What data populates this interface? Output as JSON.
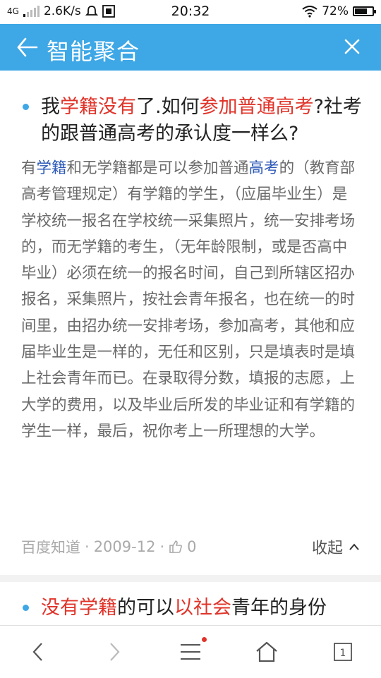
{
  "status": {
    "network": "4G",
    "speed": "2.6K/s",
    "time": "20:32",
    "battery": "72%",
    "battery_level": 0.72
  },
  "header": {
    "title": "智能聚合",
    "accent": "#3ea7e6"
  },
  "results": [
    {
      "title_parts": [
        {
          "text": "我",
          "style": "normal"
        },
        {
          "text": "学籍没有",
          "style": "red"
        },
        {
          "text": "了.如何",
          "style": "normal"
        },
        {
          "text": "参加普通高考",
          "style": "red"
        },
        {
          "text": "?社考的跟普通高考的承认度一样么?",
          "style": "normal"
        }
      ],
      "body_parts": [
        {
          "text": "有",
          "style": "normal"
        },
        {
          "text": "学籍",
          "style": "blue"
        },
        {
          "text": "和无学籍都是可以参加普通",
          "style": "normal"
        },
        {
          "text": "高考",
          "style": "blue"
        },
        {
          "text": "的（教育部高考管理规定）有学籍的学生，（应届毕业生）是学校统一报名在学校统一采集照片，统一安排考场的，而无学籍的考生，（无年龄限制，或是否高中毕业）必须在统一的报名时间，自己到所辖区招办报名，采集照片，按社会青年报名，也在统一的时间里，由招办统一安排考场，参加高考，其他和应届毕业生是一样的，无任和区别，只是填表时是填上社会青年而已。在录取得分数，填报的志愿，上大学的费用，以及毕业后所发的毕业证和有学籍的学生一样，最后，祝你考上一所理想的大学。",
          "style": "normal"
        }
      ],
      "source": "百度知道",
      "date": "2009-12",
      "likes": "0",
      "collapse_label": "收起"
    },
    {
      "title_parts": [
        {
          "text": "没有学籍",
          "style": "red"
        },
        {
          "text": "的可以",
          "style": "normal"
        },
        {
          "text": "以社会",
          "style": "red"
        },
        {
          "text": "青年的身份",
          "style": "normal"
        }
      ]
    }
  ],
  "icons": {
    "back": "arrow-left-icon",
    "close": "close-icon",
    "nav": [
      "chevron-left-icon",
      "chevron-right-icon",
      "menu-icon",
      "home-icon",
      "tabs-icon"
    ]
  },
  "tabs_count": "1"
}
